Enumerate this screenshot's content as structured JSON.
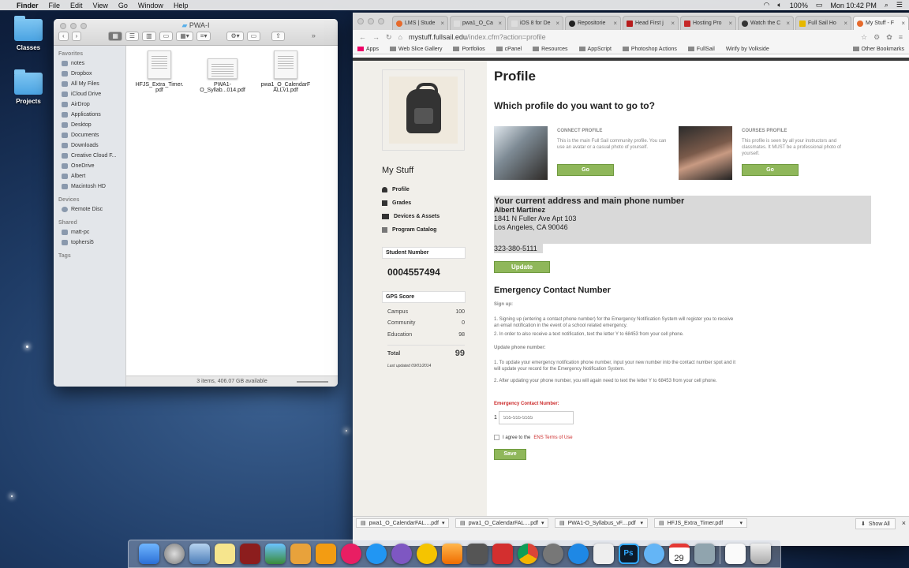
{
  "menubar": {
    "apple": "",
    "app": "Finder",
    "menus": [
      "File",
      "Edit",
      "View",
      "Go",
      "Window",
      "Help"
    ],
    "battery": "100%",
    "clock": "Mon 10:42 PM"
  },
  "desktop": {
    "icons": [
      "Classes",
      "Projects"
    ]
  },
  "finder": {
    "title": "PWA-I",
    "sidebar": {
      "favorites_header": "Favorites",
      "favorites": [
        "notes",
        "Dropbox",
        "All My Files",
        "iCloud Drive",
        "AirDrop",
        "Applications",
        "Desktop",
        "Documents",
        "Downloads",
        "Creative Cloud F...",
        "OneDrive",
        "Albert",
        "Macintosh HD"
      ],
      "devices_header": "Devices",
      "devices": [
        "Remote Disc"
      ],
      "shared_header": "Shared",
      "shared": [
        "matt-pc",
        "tophersi5"
      ],
      "tags_header": "Tags"
    },
    "files": [
      {
        "name1": "HFJS_Extra_Timer.",
        "name2": "pdf"
      },
      {
        "name1": "PWA1-",
        "name2": "O_Syllab...014.pdf"
      },
      {
        "name1": "pwa1_O_CalendarF",
        "name2": "ALLv1.pdf"
      }
    ],
    "status": "3 items, 406.07 GB available"
  },
  "chrome": {
    "tabs": [
      "LMS | Stude",
      "pwa1_O_Ca",
      "iOS 8 for De",
      "Repositorie",
      "Head First j",
      "Hosting Pro",
      "Watch the C",
      "Full Sail Ho",
      "My Stuff - F"
    ],
    "url_host": "mystuff.fullsail.edu",
    "url_path": "/index.cfm?action=profile",
    "bookmarks": [
      "Apps",
      "Web Slice Gallery",
      "Portfolios",
      "cPanel",
      "Resources",
      "AppScript",
      "Photoshop Actions",
      "FullSail",
      "Wirify by Volkside"
    ],
    "other_bookmarks": "Other Bookmarks",
    "downloads": [
      "pwa1_O_CalendarFAL....pdf",
      "pwa1_O_CalendarFAL....pdf",
      "PWA1-O_Syllabus_vF....pdf",
      "HFJS_Extra_Timer.pdf"
    ],
    "show_all": "Show All"
  },
  "profile_page": {
    "my_stuff": "My Stuff",
    "nav": [
      "Profile",
      "Grades",
      "Devices & Assets",
      "Program Catalog"
    ],
    "student_number_label": "Student Number",
    "student_number": "0004557494",
    "gps_label": "GPS Score",
    "gps": [
      {
        "label": "Campus",
        "value": "100"
      },
      {
        "label": "Community",
        "value": "0"
      },
      {
        "label": "Education",
        "value": "98"
      }
    ],
    "gps_total_label": "Total",
    "gps_total": "99",
    "last_updated": "Last updated 09/01/2014",
    "title": "Profile",
    "question": "Which profile do you want to go to?",
    "connect": {
      "label": "CONNECT PROFILE",
      "desc": "This is the main Full Sail community profile. You can use an avatar or a casual photo of yourself.",
      "btn": "Go"
    },
    "courses": {
      "label": "COURSES PROFILE",
      "desc": "This profile is seen by all your instructors and classmates. It MUST be a professional photo of yourself.",
      "btn": "Go"
    },
    "address_heading": "Your current address and main phone number",
    "name": "Albert Martinez",
    "street": "1841 N Fuller Ave Apt 103",
    "city": "Los Angeles, CA 90046",
    "phone": "323-380-5111",
    "update_btn": "Update",
    "emergency_heading": "Emergency Contact Number",
    "signup_label": "Sign up:",
    "signup_items": [
      "1.  Signing up (entering a contact phone number) for the Emergency Notification System will register you to receive an email notification in the event of a school related emergency.",
      "2.  In order to also receive a text notification, text the letter Y to 68453 from your cell phone."
    ],
    "update_phone_label": "Update phone number:",
    "update_items": [
      "1.  To update your emergency notification phone number, input your new number into the contact number spot and it will update your record for the Emergency Notification System.",
      "2.  After updating your phone number, you will again need to text the letter Y to 68453 from your cell phone."
    ],
    "ec_label": "Emergency Contact Number:",
    "ec_prefix": "1",
    "ec_placeholder": "555-555-5555",
    "agree_text": "I agree to the",
    "agree_link": "ENS Terms of Use",
    "save_btn": "Save"
  },
  "dock": {
    "calendar_day": "29"
  }
}
